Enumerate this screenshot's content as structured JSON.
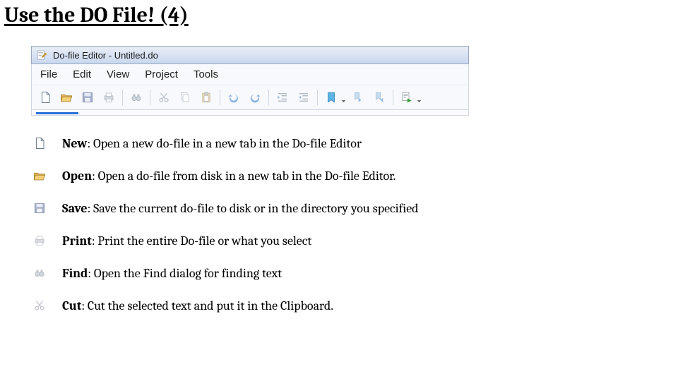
{
  "title": "Use the DO File! (4)",
  "editor": {
    "window_title": "Do-file Editor - Untitled.do",
    "menus": [
      "File",
      "Edit",
      "View",
      "Project",
      "Tools"
    ]
  },
  "legend": [
    {
      "label": "New",
      "desc": ": Open a new do-file in a new tab in the Do-file Editor"
    },
    {
      "label": "Open",
      "desc": ": Open a do-file from disk in a new tab in the Do-file Editor."
    },
    {
      "label": "Save",
      "desc": ": Save the current do-file to disk or in the directory you specified"
    },
    {
      "label": "Print",
      "desc": ": Print the entire Do-file or what you select"
    },
    {
      "label": "Find",
      "desc": ": Open the Find dialog for finding text"
    },
    {
      "label": "Cut",
      "desc": ": Cut the selected text and put it in the Clipboard."
    }
  ]
}
